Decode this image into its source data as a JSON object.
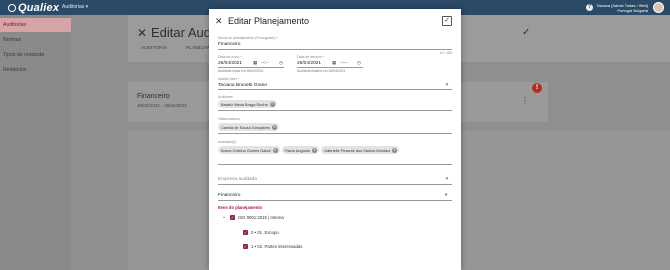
{
  "topbar": {
    "logo": "Qualiex",
    "module": "Auditorias ▾",
    "user_name": "Taciana [Admin Todas / Web]",
    "user_sub": "Portugal Bulgaria"
  },
  "sidebar": {
    "items": [
      {
        "label": "Auditorias",
        "active": true
      },
      {
        "label": "Normas",
        "active": false
      },
      {
        "label": "Tipos de resposta",
        "active": false
      },
      {
        "label": "Relatórios",
        "active": false
      }
    ]
  },
  "background": {
    "title": "Editar Auditori",
    "tabs": [
      "AUDITORIA",
      "PLANEJAM"
    ],
    "card_title": "Financeiro",
    "card_dates": "26/04/2021 - 26/04/2021",
    "alert": "!"
  },
  "modal": {
    "title": "Editar Planejamento",
    "name": {
      "label": "Nome do planejamento (Portuguese) *",
      "value": "Financeiro",
      "counter": "10 / 150"
    },
    "start_date": {
      "label": "Data de início *",
      "value": "26/04/2021",
      "time_placeholder": "--:--",
      "hint": "Auditoria inicia em 26/04/2021"
    },
    "end_date": {
      "label": "Data de término *",
      "value": "26/04/2021",
      "time_placeholder": "--:--",
      "hint": "Auditoria finaliza em 26/04/2021"
    },
    "leader": {
      "label": "Auditor líder *",
      "value": "Taciana Brunetti Grano"
    },
    "auditors": {
      "label": "Auditores",
      "chips": [
        "Beatriz Maria Braga Rocha"
      ]
    },
    "observers": {
      "label": "Observadores",
      "chips": [
        "Camila de Souza Gonçalves"
      ]
    },
    "audited": {
      "label": "Auditado(s)",
      "chips": [
        "Bruna Cristina Gomes Dabul",
        "Flavio Augusto",
        "Gabrielle Pessute dos Santos Montani"
      ]
    },
    "company": {
      "placeholder": "Empresa auditada"
    },
    "area": {
      "value": "Financeiro"
    },
    "items": {
      "title": "Itens do planejamento",
      "tree": [
        {
          "label": "ISO 9001:2015 | Interna",
          "checked": true
        },
        {
          "label": "0 • 01. Escopo",
          "checked": true
        },
        {
          "label": "1 • 02. Partes interessadas",
          "checked": true
        }
      ]
    }
  },
  "colors": {
    "topbar": "#2a4a68",
    "accent": "#8b2641",
    "section_title": "#a3223a",
    "sidebar_active": "#d6a3a6"
  },
  "icons": {
    "close": "close-icon",
    "save": "check-icon",
    "calendar": "calendar-icon",
    "clock": "clock-icon",
    "clear": "clear-icon",
    "dropdown": "chevron-down-icon"
  }
}
